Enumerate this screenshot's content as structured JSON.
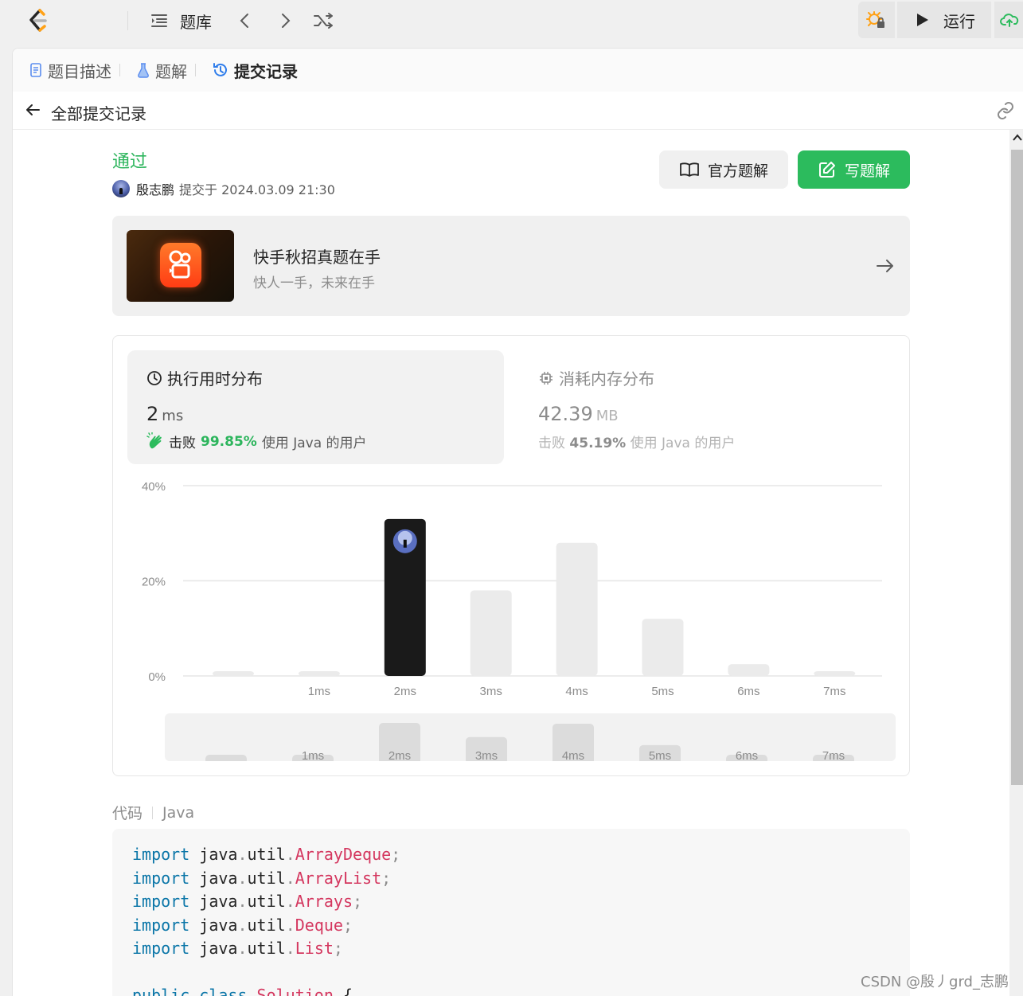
{
  "topbar": {
    "problem_list": "题库",
    "run_label": "运行"
  },
  "tabs": [
    {
      "label": "题目描述"
    },
    {
      "label": "题解"
    },
    {
      "label": "提交记录"
    }
  ],
  "subheader": {
    "title": "全部提交记录"
  },
  "submission": {
    "status": "通过",
    "user": "殷志鹏",
    "meta": "提交于 2024.03.09 21:30"
  },
  "buttons": {
    "official": "官方题解",
    "write": "写题解"
  },
  "promo": {
    "title": "快手秋招真题在手",
    "subtitle": "快人一手，未来在手"
  },
  "runtime": {
    "title": "执行用时分布",
    "value": "2",
    "unit": "ms",
    "beat_prefix": "击败",
    "beat_pct": "99.85%",
    "beat_suffix": "使用 Java 的用户"
  },
  "memory": {
    "title": "消耗内存分布",
    "value": "42.39",
    "unit": "MB",
    "beat_prefix": "击败",
    "beat_pct": "45.19%",
    "beat_suffix": "使用 Java 的用户"
  },
  "chart_data": {
    "type": "bar",
    "categories": [
      "",
      "1ms",
      "2ms",
      "3ms",
      "4ms",
      "5ms",
      "6ms",
      "7ms"
    ],
    "values": [
      1,
      1,
      33,
      18,
      28,
      12,
      2.5,
      1
    ],
    "highlight_index": 2,
    "yticks": [
      "40%",
      "20%",
      "0%"
    ],
    "ylim": [
      0,
      40
    ],
    "colors": {
      "bar": "#ebebeb",
      "highlight": "#1a1a1a",
      "grid": "#e6e6e6"
    }
  },
  "code": {
    "label": "代码",
    "language": "Java",
    "lines": [
      {
        "kw": "import",
        "pkg": "java.util.",
        "cls": "ArrayDeque"
      },
      {
        "kw": "import",
        "pkg": "java.util.",
        "cls": "ArrayList"
      },
      {
        "kw": "import",
        "pkg": "java.util.",
        "cls": "Arrays"
      },
      {
        "kw": "import",
        "pkg": "java.util.",
        "cls": "Deque"
      },
      {
        "kw": "import",
        "pkg": "java.util.",
        "cls": "List"
      }
    ],
    "last_line": {
      "kw": "public class",
      "cls": "Solution",
      "brace": "{"
    }
  },
  "watermark": "CSDN @殷丿grd_志鹏"
}
